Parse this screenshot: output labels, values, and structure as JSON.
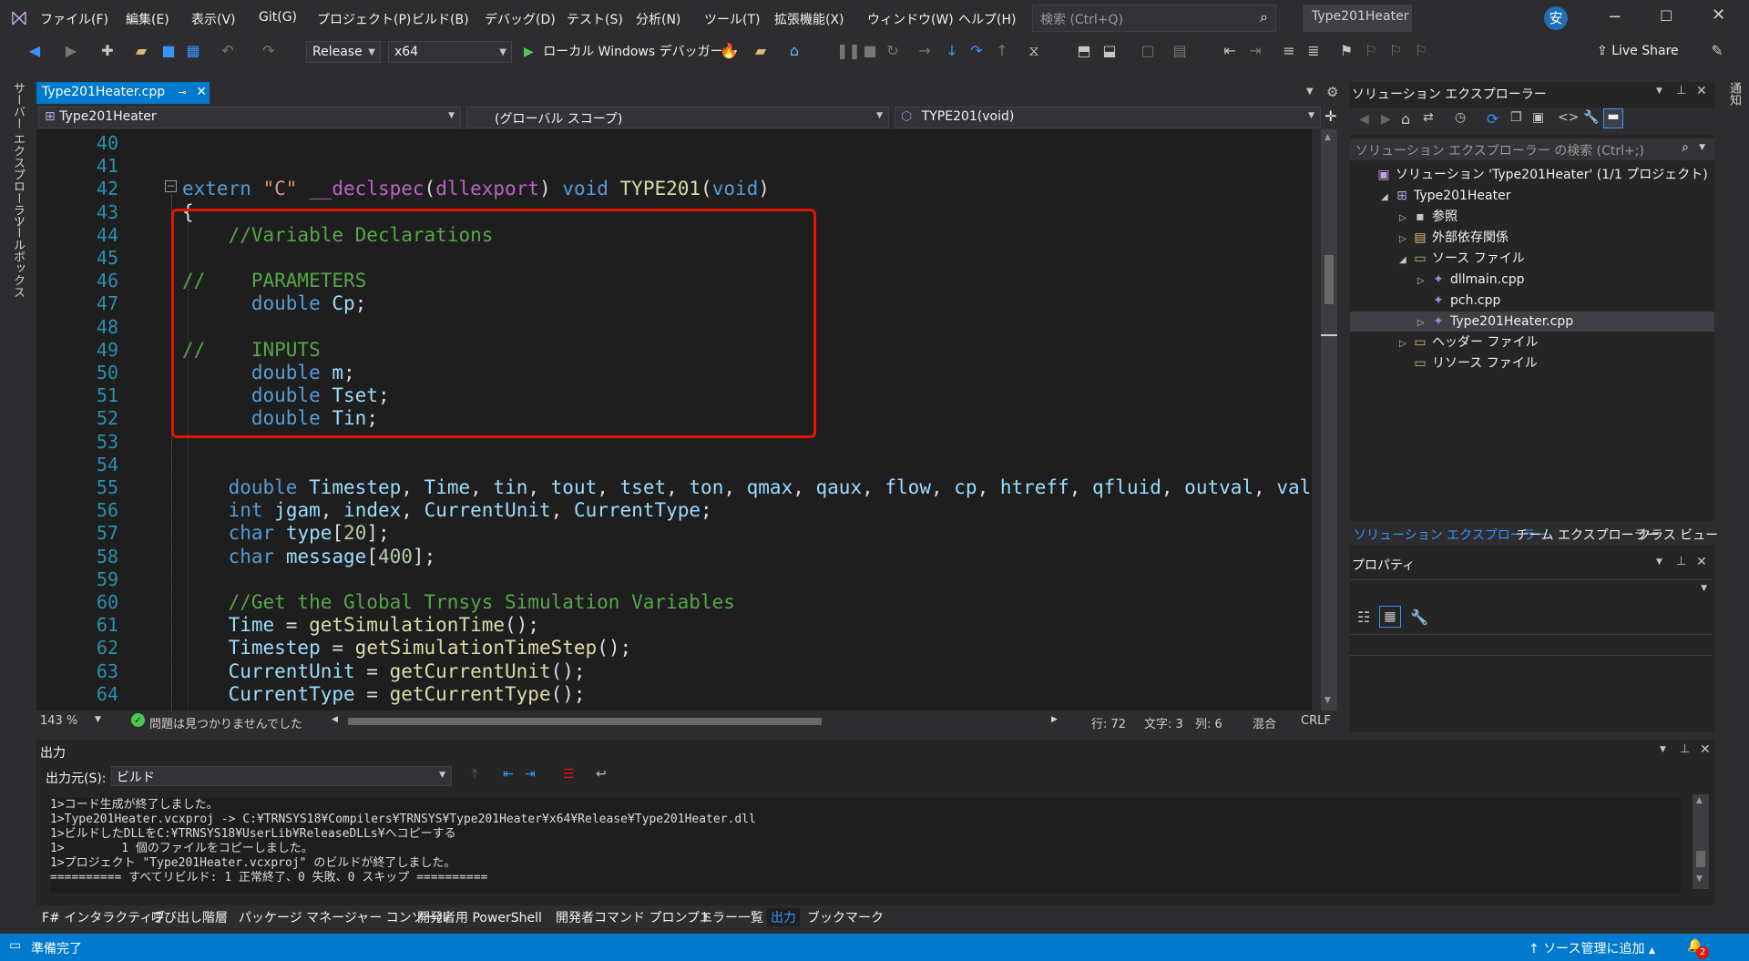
{
  "title_bar": {
    "menus": [
      "ファイル(F)",
      "編集(E)",
      "表示(V)",
      "Git(G)",
      "プロジェクト(P)",
      "ビルド(B)",
      "デバッグ(D)",
      "テスト(S)",
      "分析(N)",
      "ツール(T)",
      "拡張機能(X)",
      "ウィンドウ(W)",
      "ヘルプ(H)"
    ],
    "search_placeholder": "検索 (Ctrl+Q)",
    "solution_name": "Type201Heater",
    "user_initial": "安"
  },
  "toolbar": {
    "config": "Release",
    "platform": "x64",
    "debugger": "ローカル Windows デバッガー",
    "live_share": "Live Share"
  },
  "left_strip": {
    "tabs": [
      "サーバー エクスプローラー",
      "ツールボックス"
    ]
  },
  "editor": {
    "tab_name": "Type201Heater.cpp",
    "nav_project": "Type201Heater",
    "nav_scope": "(グローバル スコープ)",
    "nav_member": "TYPE201(void)",
    "zoom": "143 %",
    "issues": "問題は見つかりませんでした",
    "line": "行: 72",
    "char": "文字: 3",
    "col": "列: 6",
    "mixed": "混合",
    "eol": "CRLF"
  },
  "code_lines": [
    {
      "n": "40",
      "t": ""
    },
    {
      "n": "41",
      "t": ""
    },
    {
      "n": "42",
      "t": "extern \"C\" __declspec(dllexport) void TYPE201(void)"
    },
    {
      "n": "43",
      "t": "{"
    },
    {
      "n": "44",
      "t": "    //Variable Declarations"
    },
    {
      "n": "45",
      "t": ""
    },
    {
      "n": "46",
      "t": "//    PARAMETERS"
    },
    {
      "n": "47",
      "t": "      double Cp;"
    },
    {
      "n": "48",
      "t": ""
    },
    {
      "n": "49",
      "t": "//    INPUTS"
    },
    {
      "n": "50",
      "t": "      double m;"
    },
    {
      "n": "51",
      "t": "      double Tset;"
    },
    {
      "n": "52",
      "t": "      double Tin;"
    },
    {
      "n": "53",
      "t": ""
    },
    {
      "n": "54",
      "t": ""
    },
    {
      "n": "55",
      "t": "    double Timestep, Time, tin, tout, tset, ton, qmax, qaux, flow, cp, htreff, qfluid, outval, val;"
    },
    {
      "n": "56",
      "t": "    int jgam, index, CurrentUnit, CurrentType;"
    },
    {
      "n": "57",
      "t": "    char type[20];"
    },
    {
      "n": "58",
      "t": "    char message[400];"
    },
    {
      "n": "59",
      "t": ""
    },
    {
      "n": "60",
      "t": "    //Get the Global Trnsys Simulation Variables"
    },
    {
      "n": "61",
      "t": "    Time = getSimulationTime();"
    },
    {
      "n": "62",
      "t": "    Timestep = getSimulationTimeStep();"
    },
    {
      "n": "63",
      "t": "    CurrentUnit = getCurrentUnit();"
    },
    {
      "n": "64",
      "t": "    CurrentType = getCurrentType();"
    }
  ],
  "solution_explorer": {
    "title": "ソリューション エクスプローラー",
    "search": "ソリューション エクスプローラー の検索 (Ctrl+;)",
    "tree": [
      {
        "label": "ソリューション 'Type201Heater' (1/1 プロジェクト)",
        "indent": 0,
        "tri": "",
        "icon": "solution-icon",
        "glyph": "▣"
      },
      {
        "label": "Type201Heater",
        "indent": 1,
        "tri": "◢",
        "icon": "project-icon",
        "glyph": "⊞"
      },
      {
        "label": "参照",
        "indent": 2,
        "tri": "▷",
        "icon": "references-icon",
        "glyph": "▪"
      },
      {
        "label": "外部依存関係",
        "indent": 2,
        "tri": "▷",
        "icon": "external-deps-icon",
        "glyph": "▤"
      },
      {
        "label": "ソース ファイル",
        "indent": 2,
        "tri": "◢",
        "icon": "folder-icon",
        "glyph": "▭"
      },
      {
        "label": "dllmain.cpp",
        "indent": 3,
        "tri": "▷",
        "icon": "cpp-file-icon",
        "glyph": "✦"
      },
      {
        "label": "pch.cpp",
        "indent": 3,
        "tri": "",
        "icon": "cpp-file-icon",
        "glyph": "✦"
      },
      {
        "label": "Type201Heater.cpp",
        "indent": 3,
        "tri": "▷",
        "icon": "cpp-file-icon",
        "glyph": "✦",
        "selected": true
      },
      {
        "label": "ヘッダー ファイル",
        "indent": 2,
        "tri": "▷",
        "icon": "folder-icon",
        "glyph": "▭"
      },
      {
        "label": "リソース ファイル",
        "indent": 2,
        "tri": "",
        "icon": "folder-icon",
        "glyph": "▭"
      }
    ],
    "tabs": [
      "ソリューション エクスプローラー",
      "チーム エクスプローラー",
      "クラス ビュー"
    ]
  },
  "properties": {
    "title": "プロパティ"
  },
  "output": {
    "title": "出力",
    "source_label": "出力元(S):",
    "source": "ビルド",
    "lines": [
      "1>コード生成が終了しました。",
      "1>Type201Heater.vcxproj -> C:¥TRNSYS18¥Compilers¥TRNSYS¥Type201Heater¥x64¥Release¥Type201Heater.dll",
      "1>ビルドしたDLLをC:¥TRNSYS18¥UserLib¥ReleaseDLLs¥へコピーする",
      "1>        1 個のファイルをコピーしました。",
      "1>プロジェクト \"Type201Heater.vcxproj\" のビルドが終了しました。",
      "========== すべてリビルド: 1 正常終了、0 失敗、0 スキップ =========="
    ]
  },
  "bottom_tabs": [
    "F# インタラクティブ",
    "呼び出し階層",
    "パッケージ マネージャー コンソール",
    "開発者用 PowerShell",
    "開発者コマンド プロンプト",
    "エラー一覧",
    "出力",
    "ブックマーク"
  ],
  "status": {
    "ready": "準備完了",
    "source_control": "ソース管理に追加",
    "notif_count": "2"
  },
  "right_strip": {
    "tab": "通知"
  }
}
